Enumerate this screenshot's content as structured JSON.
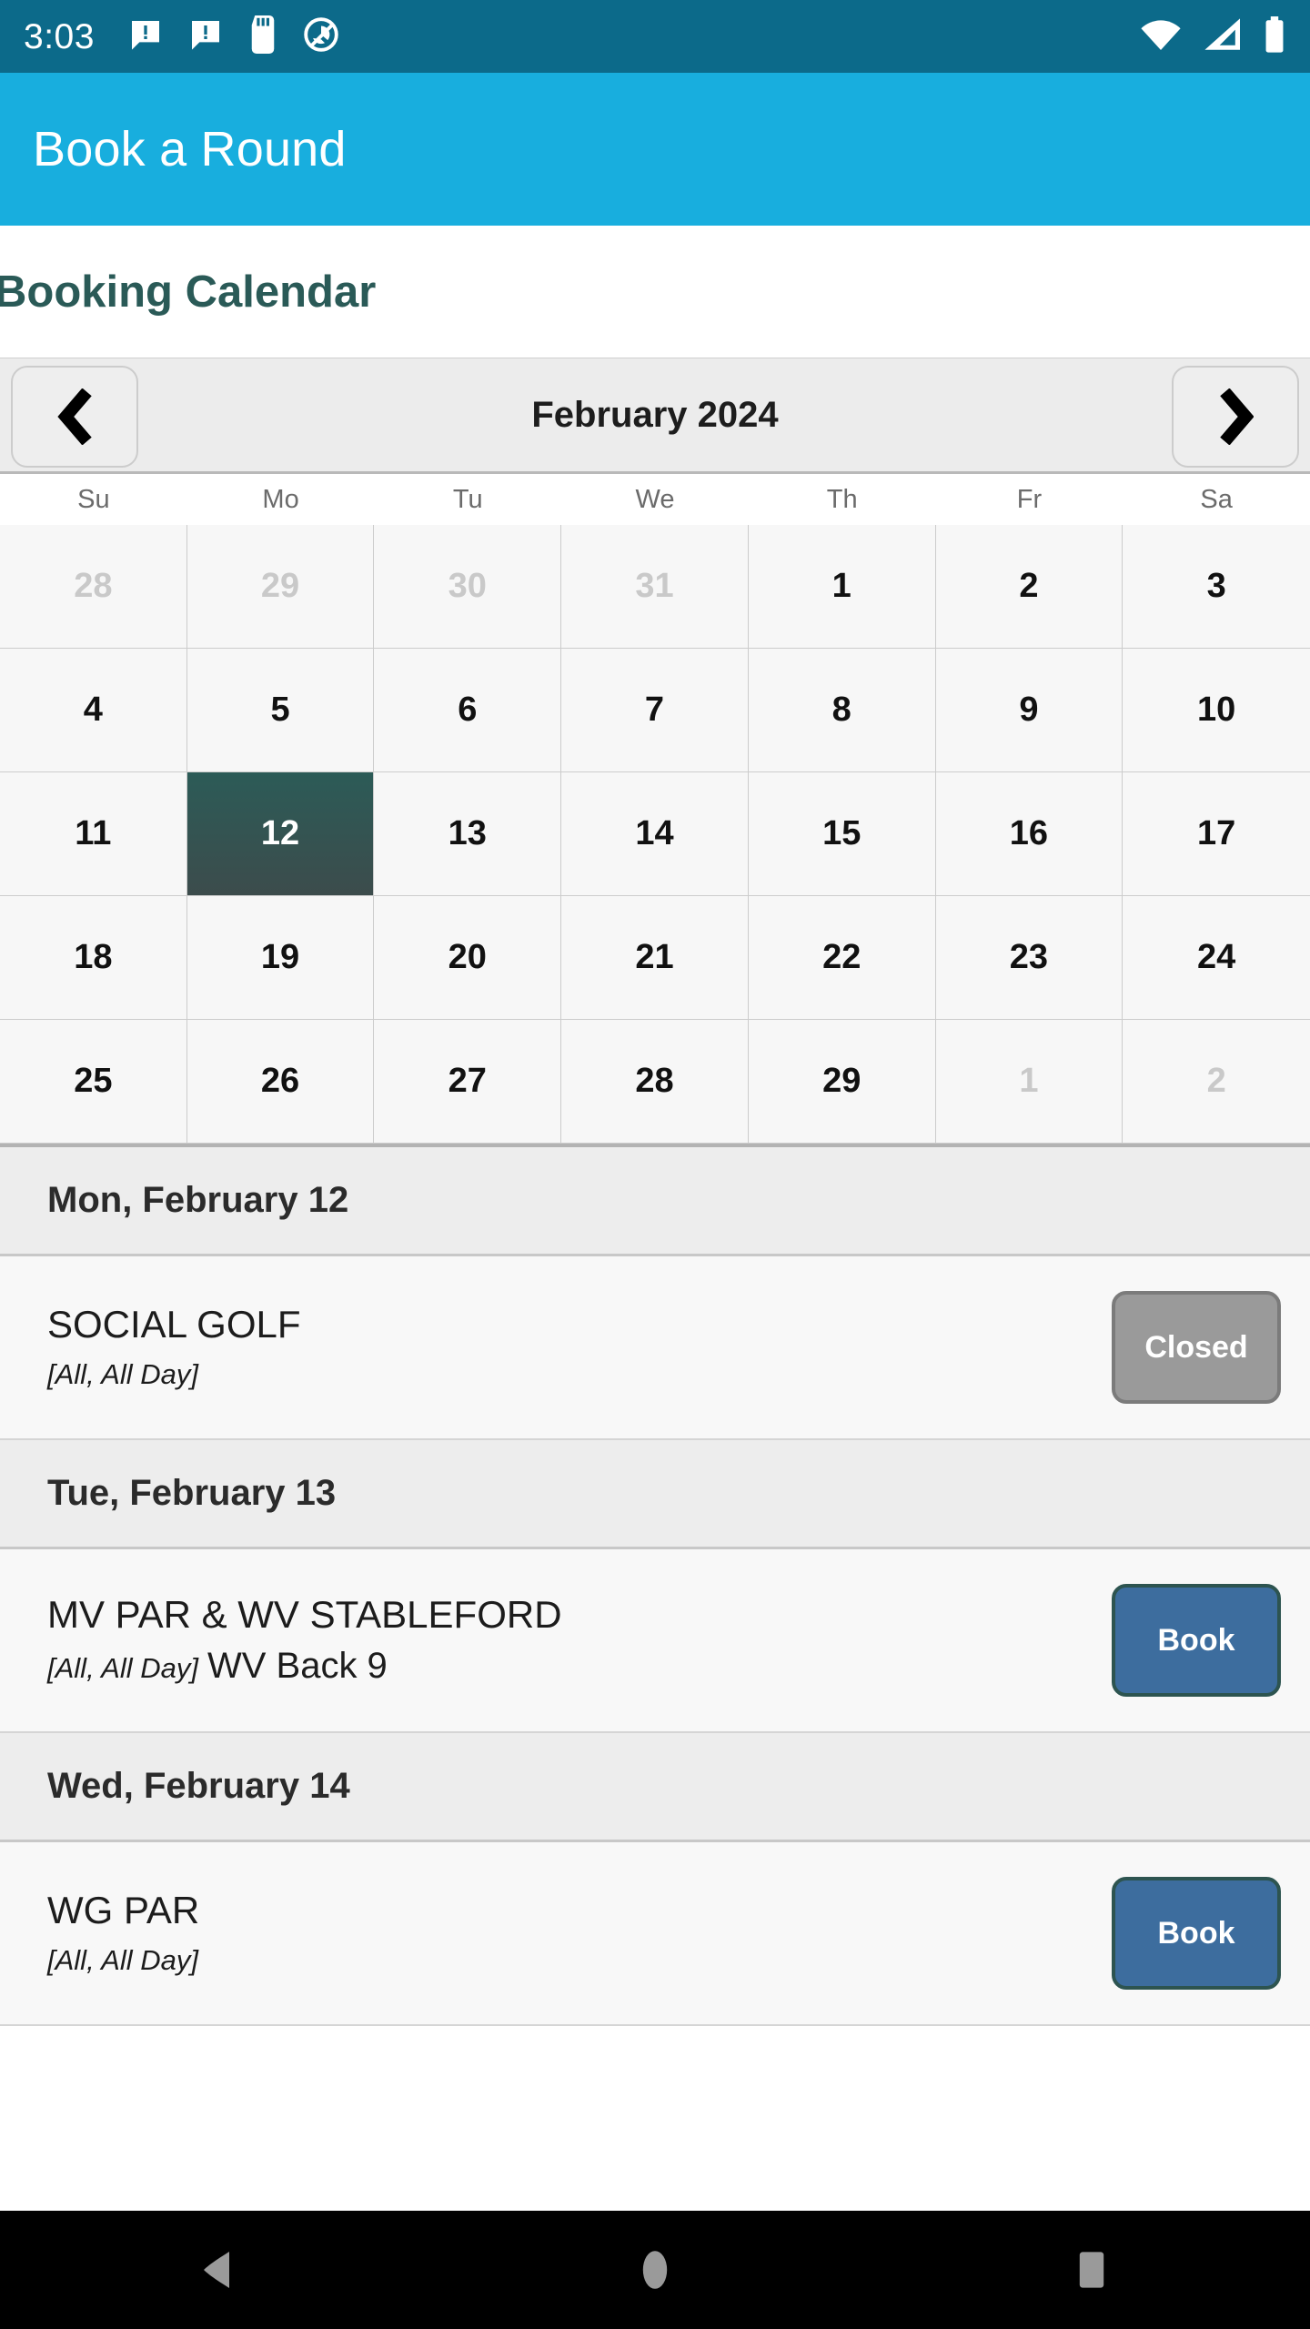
{
  "statusbar": {
    "time": "3:03",
    "left_icons": [
      "message-alert-icon",
      "message-alert-icon",
      "sd-card-icon",
      "do-not-disturb-icon"
    ],
    "right_icons": [
      "wifi-icon",
      "cellular-signal-icon",
      "battery-icon"
    ],
    "background": "#0c6a8a"
  },
  "appbar": {
    "title": "Book a Round",
    "background": "#18aede"
  },
  "page": {
    "title": "Booking Calendar",
    "title_color": "#2a5a57"
  },
  "calendar": {
    "month_label": "February 2024",
    "prev_label": "❮",
    "next_label": "❯",
    "day_headers": [
      "Su",
      "Mo",
      "Tu",
      "We",
      "Th",
      "Fr",
      "Sa"
    ],
    "selected_day": "12",
    "selected_color": "#2c5b57",
    "weeks": [
      [
        {
          "d": "28",
          "muted": true
        },
        {
          "d": "29",
          "muted": true
        },
        {
          "d": "30",
          "muted": true
        },
        {
          "d": "31",
          "muted": true
        },
        {
          "d": "1",
          "muted": false
        },
        {
          "d": "2",
          "muted": false
        },
        {
          "d": "3",
          "muted": false
        }
      ],
      [
        {
          "d": "4",
          "muted": false
        },
        {
          "d": "5",
          "muted": false
        },
        {
          "d": "6",
          "muted": false
        },
        {
          "d": "7",
          "muted": false
        },
        {
          "d": "8",
          "muted": false
        },
        {
          "d": "9",
          "muted": false
        },
        {
          "d": "10",
          "muted": false
        }
      ],
      [
        {
          "d": "11",
          "muted": false
        },
        {
          "d": "12",
          "muted": false,
          "selected": true
        },
        {
          "d": "13",
          "muted": false
        },
        {
          "d": "14",
          "muted": false
        },
        {
          "d": "15",
          "muted": false
        },
        {
          "d": "16",
          "muted": false
        },
        {
          "d": "17",
          "muted": false
        }
      ],
      [
        {
          "d": "18",
          "muted": false
        },
        {
          "d": "19",
          "muted": false
        },
        {
          "d": "20",
          "muted": false
        },
        {
          "d": "21",
          "muted": false
        },
        {
          "d": "22",
          "muted": false
        },
        {
          "d": "23",
          "muted": false
        },
        {
          "d": "24",
          "muted": false
        }
      ],
      [
        {
          "d": "25",
          "muted": false
        },
        {
          "d": "26",
          "muted": false
        },
        {
          "d": "27",
          "muted": false
        },
        {
          "d": "28",
          "muted": false
        },
        {
          "d": "29",
          "muted": false
        },
        {
          "d": "1",
          "muted": true
        },
        {
          "d": "2",
          "muted": true
        }
      ]
    ]
  },
  "sections": [
    {
      "day_label": "Mon, February 12",
      "events": [
        {
          "title": "SOCIAL GOLF",
          "bracket": "[All, All Day]",
          "extra": "",
          "action_label": "Closed",
          "action_kind": "closed",
          "action_color": "#9a9a9a"
        }
      ]
    },
    {
      "day_label": "Tue, February 13",
      "events": [
        {
          "title": "MV PAR & WV STABLEFORD",
          "bracket": "[All, All Day]",
          "extra": "WV Back 9",
          "action_label": "Book",
          "action_kind": "book",
          "action_color": "#3d6d9e"
        }
      ]
    },
    {
      "day_label": "Wed, February 14",
      "events": [
        {
          "title": "WG PAR",
          "bracket": "[All, All Day]",
          "extra": "",
          "action_label": "Book",
          "action_kind": "book",
          "action_color": "#3d6d9e"
        }
      ]
    }
  ],
  "androidnav": {
    "items": [
      "back-icon",
      "home-icon",
      "recents-icon"
    ],
    "background": "#000000"
  }
}
